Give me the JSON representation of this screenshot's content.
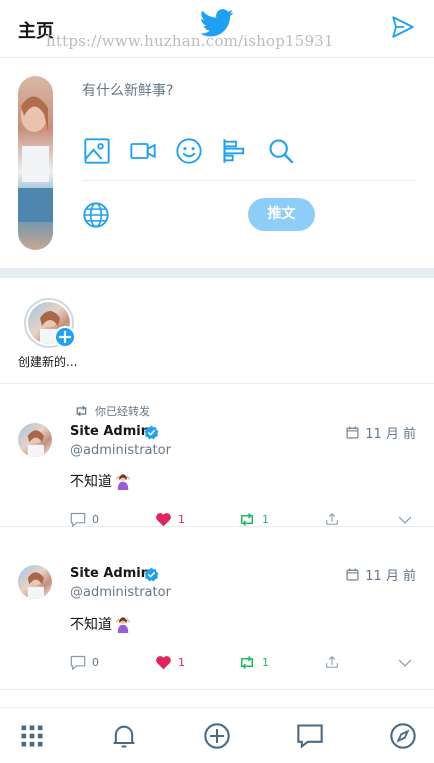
{
  "header": {
    "title": "主页",
    "watermark": "https://www.huzhan.com/ishop15931",
    "logo_icon": "twitter-bird-icon",
    "send_icon": "paper-plane-icon",
    "accent_color": "#1da1f2"
  },
  "compose": {
    "placeholder": "有什么新鲜事?",
    "tools": [
      "image-icon",
      "video-icon",
      "emoji-icon",
      "poll-icon",
      "search-icon"
    ],
    "globe_icon": "globe-icon",
    "submit_label": "推文",
    "submit_color": "#8ecdf8"
  },
  "stories": {
    "create_label": "创建新的..."
  },
  "tweets": [
    {
      "retweet_note": "你已经转发",
      "name": "Site Admin",
      "handle": "@administrator",
      "time": "11 月 前",
      "text": "不知道",
      "emoji": "person-shrugging-icon",
      "replies": "0",
      "likes": "1",
      "retweets": "1",
      "liked": true,
      "retweeted": true
    },
    {
      "name": "Site Admin",
      "handle": "@administrator",
      "time": "11 月 前",
      "text": "不知道",
      "emoji": "person-shrugging-icon",
      "replies": "0",
      "likes": "1",
      "retweets": "1",
      "liked": true,
      "retweeted": true
    }
  ],
  "tabbar": {
    "items": [
      "grid-icon",
      "bell-icon",
      "plus-circle-icon",
      "chat-icon",
      "compass-icon"
    ]
  },
  "colors": {
    "like": "#e0245e",
    "retweet": "#17bf63",
    "muted": "#657786"
  }
}
